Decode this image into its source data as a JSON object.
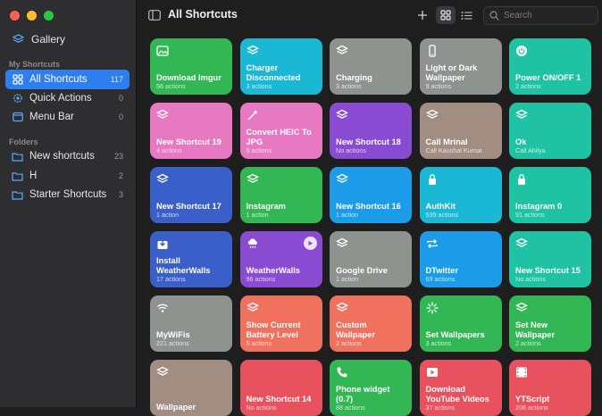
{
  "window": {
    "title": "All Shortcuts"
  },
  "sidebar": {
    "gallery_label": "Gallery",
    "my_shortcuts_header": "My Shortcuts",
    "folders_header": "Folders",
    "items": [
      {
        "label": "All Shortcuts",
        "count": "117"
      },
      {
        "label": "Quick Actions",
        "count": "0"
      },
      {
        "label": "Menu Bar",
        "count": "0"
      }
    ],
    "folders": [
      {
        "label": "New shortcuts",
        "count": "23"
      },
      {
        "label": "H",
        "count": "2"
      },
      {
        "label": "Starter Shortcuts",
        "count": "3"
      }
    ]
  },
  "toolbar": {
    "search_placeholder": "Search"
  },
  "colors": {
    "accent": "#2f7ef0"
  },
  "shortcuts": [
    {
      "name": "Download Imgur",
      "sub": "56 actions",
      "icon": "photo-icon",
      "color": "#33b654"
    },
    {
      "name": "Charger Disconnected",
      "sub": "3 actions",
      "icon": "layers-icon",
      "color": "#1bb8d6"
    },
    {
      "name": "Charging",
      "sub": "3 actions",
      "icon": "layers-icon",
      "color": "#8e9390"
    },
    {
      "name": "Light or Dark Wallpaper",
      "sub": "9 actions",
      "icon": "phone-icon",
      "color": "#8e9390"
    },
    {
      "name": "Power ON/OFF 1",
      "sub": "2 actions",
      "icon": "power-icon",
      "color": "#1fc2a2"
    },
    {
      "name": "New Shortcut 19",
      "sub": "4 actions",
      "icon": "layers-icon",
      "color": "#e778c2"
    },
    {
      "name": "Convert HEIC To JPG",
      "sub": "5 actions",
      "icon": "wand-icon",
      "color": "#e778c2"
    },
    {
      "name": "New Shortcut 18",
      "sub": "No actions",
      "icon": "layers-icon",
      "color": "#8a4bd3"
    },
    {
      "name": "Call Mrinal",
      "sub": "Call Kaushal Kumar",
      "icon": "layers-icon",
      "color": "#a28d83"
    },
    {
      "name": "Ok",
      "sub": "Call Ahilya",
      "icon": "layers-icon",
      "color": "#1fc2a2"
    },
    {
      "name": "New Shortcut 17",
      "sub": "1 action",
      "icon": "layers-icon",
      "color": "#3b5fc9"
    },
    {
      "name": "Instagram",
      "sub": "1 action",
      "icon": "layers-icon",
      "color": "#33b654"
    },
    {
      "name": "New Shortcut 16",
      "sub": "1 action",
      "icon": "layers-icon",
      "color": "#1c9ce8"
    },
    {
      "name": "AuthKit",
      "sub": "539 actions",
      "icon": "lock-icon",
      "color": "#1bb8d6"
    },
    {
      "name": "Instagram 0",
      "sub": "91 actions",
      "icon": "lock-icon",
      "color": "#1fc2a2"
    },
    {
      "name": "Install WeatherWalls",
      "sub": "17 actions",
      "icon": "download-icon",
      "color": "#3b5fc9"
    },
    {
      "name": "WeatherWalls",
      "sub": "96 actions",
      "icon": "cloud-icon",
      "color": "#8a4bd3",
      "run": true
    },
    {
      "name": "Google Drive",
      "sub": "1 action",
      "icon": "layers-icon",
      "color": "#8e9390"
    },
    {
      "name": "DTwitter",
      "sub": "69 actions",
      "icon": "repeat-icon",
      "color": "#1c9ce8"
    },
    {
      "name": "New Shortcut 15",
      "sub": "No actions",
      "icon": "layers-icon",
      "color": "#1fc2a2"
    },
    {
      "name": "MyWiFis",
      "sub": "221 actions",
      "icon": "wifi-icon",
      "color": "#8e9390"
    },
    {
      "name": "Show Current Battery Level",
      "sub": "5 actions",
      "icon": "layers-icon",
      "color": "#f0715e"
    },
    {
      "name": "Custom Wallpaper",
      "sub": "2 actions",
      "icon": "layers-icon",
      "color": "#f0715e"
    },
    {
      "name": "Set Wallpapers",
      "sub": "3 actions",
      "icon": "spinner-icon",
      "color": "#33b654"
    },
    {
      "name": "Set New Wallpaper",
      "sub": "2 actions",
      "icon": "layers-icon",
      "color": "#33b654"
    },
    {
      "name": "Wallpaper",
      "sub": "",
      "icon": "layers-icon",
      "color": "#a28d83"
    },
    {
      "name": "New Shortcut 14",
      "sub": "No actions",
      "icon": "",
      "color": "#e8525f"
    },
    {
      "name": "Phone widget (0.7)",
      "sub": "88 actions",
      "icon": "phone-call-icon",
      "color": "#33b654"
    },
    {
      "name": "Download YouTube Videos",
      "sub": "37 actions",
      "icon": "play-icon",
      "color": "#e8525f"
    },
    {
      "name": "YTScript",
      "sub": "206 actions",
      "icon": "film-icon",
      "color": "#e8525f"
    }
  ]
}
